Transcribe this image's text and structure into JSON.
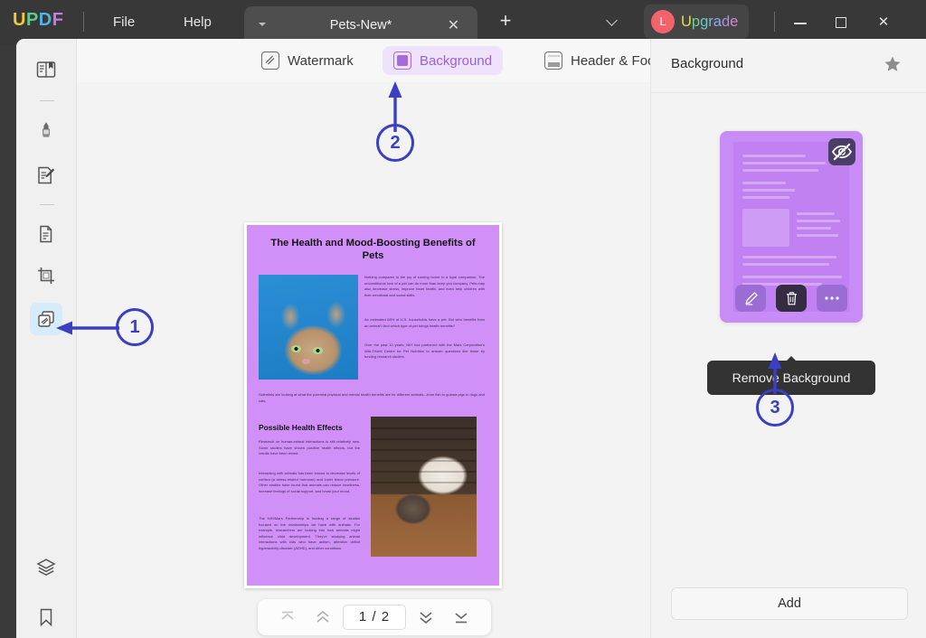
{
  "app": {
    "name": "UPDF",
    "logo_letters": [
      "U",
      "P",
      "D",
      "F"
    ]
  },
  "titlebar": {
    "menus": [
      {
        "label": "File",
        "name": "menu-file"
      },
      {
        "label": "Help",
        "name": "menu-help"
      }
    ],
    "tab": {
      "title": "Pets-New*",
      "close_label": "✕",
      "caret_icon": "chevron-down-icon"
    },
    "new_tab_label": "+",
    "tab_list_icon": "chevron-down-icon",
    "upgrade": {
      "label": "Upgrade",
      "avatar_initial": "L",
      "avatar_color": "#f4636c"
    },
    "window_controls": {
      "minimize": "minimize-icon",
      "maximize": "maximize-icon",
      "close": "✕"
    }
  },
  "sidebar": {
    "items": [
      {
        "label": "Reader",
        "icon": "reader-book-icon",
        "active": false
      },
      {
        "label": "Annotate",
        "icon": "highlighter-marker-icon",
        "active": false
      },
      {
        "label": "Edit PDF",
        "icon": "edit-document-pencil-icon",
        "active": false
      },
      {
        "label": "Organize Pages",
        "icon": "page-organize-icon",
        "active": false
      },
      {
        "label": "Crop Pages",
        "icon": "crop-icon",
        "active": false
      },
      {
        "label": "Watermark & Background",
        "icon": "watermark-pages-icon",
        "active": true
      },
      {
        "label": "Layers",
        "icon": "layers-icon",
        "active": false
      },
      {
        "label": "Bookmarks",
        "icon": "bookmark-icon",
        "active": false
      }
    ]
  },
  "toolbar": {
    "tabs": [
      {
        "label": "Watermark",
        "icon": "watermark-icon",
        "active": false
      },
      {
        "label": "Background",
        "icon": "background-icon",
        "active": true
      },
      {
        "label": "Header & Footer",
        "icon": "header-footer-icon",
        "active": false
      }
    ],
    "active_color": "#9b5fd9",
    "active_bg": "#efe2fb"
  },
  "document": {
    "background_color": "#d190f8",
    "title": "The Health and Mood-Boosting Benefits of Pets",
    "section_heading": "Possible Health Effects",
    "paragraphs": [
      "Nothing compares to the joy of coming home to a loyal companion. The unconditional love of a pet can do more than keep you company. Pets may also decrease stress, improve heart health, and even help children with their emotional and social skills.",
      "An estimated 68% of U.S. households have a pet. But who benefits from an animal? And which type of pet brings health benefits?",
      "Over the past 10 years, NIH has partnered with the Mars Corporation's WALTHAM Centre for Pet Nutrition to answer questions like these by funding research studies.",
      "Scientists are looking at what the potential physical and mental health benefits are for different animals—from fish to guinea pigs to dogs and cats.",
      "Research on human-animal interactions is still relatively new. Some studies have shown positive health effects, but the results have been mixed.",
      "Interacting with animals has been shown to decrease levels of cortisol (a stress-related hormone) and lower blood pressure. Other studies have found that animals can reduce loneliness, increase feelings of social support, and boost your mood.",
      "The NIH/Mars Partnership is funding a range of studies focused on the relationships we have with animals. For example, researchers are looking into how animals might influence child development. They're studying animal interactions with kids who have autism, attention deficit hyperactivity disorder (ADHD), and other conditions."
    ],
    "images": [
      {
        "name": "cat-photo",
        "alt": "Close-up of a tabby cat against a blue sky"
      },
      {
        "name": "dog-cat-photo",
        "alt": "Dog and cat resting together on a wooden floor"
      }
    ]
  },
  "page_nav": {
    "first_label": "first-page-icon",
    "prev_label": "previous-page-icon",
    "current": "1 / 2",
    "next_label": "next-page-icon",
    "last_label": "last-page-icon",
    "first_disabled": true,
    "prev_disabled": true
  },
  "right_panel": {
    "title": "Background",
    "star_icon": "star-filled-icon",
    "card": {
      "hide_icon": "eye-off-icon",
      "actions": [
        {
          "label": "Edit Background",
          "icon": "pencil-icon",
          "active": false
        },
        {
          "label": "Remove Background",
          "icon": "trash-icon",
          "active": true
        },
        {
          "label": "More options",
          "icon": "ellipsis-icon",
          "active": false
        }
      ]
    },
    "tooltip": "Remove Background",
    "add_label": "Add"
  },
  "annotations": [
    {
      "number": "1",
      "target": "sidebar-item-watermark-background",
      "direction": "left",
      "color": "#3a3fc4"
    },
    {
      "number": "2",
      "target": "toolbar-tab-background",
      "direction": "up",
      "color": "#3a3fc4"
    },
    {
      "number": "3",
      "target": "remove-background-tooltip",
      "direction": "up",
      "color": "#3a3fc4"
    }
  ]
}
